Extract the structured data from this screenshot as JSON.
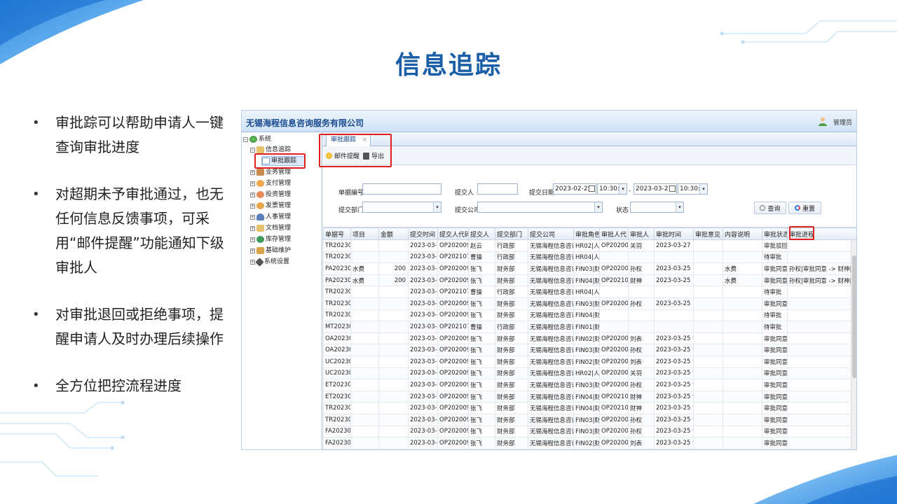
{
  "slide": {
    "title": "信息追踪",
    "bullets": [
      "审批踪可以帮助申请人一键查询审批进度",
      "对超期未予审批通过，也无任何信息反馈事项，可采用“邮件提醒”功能通知下级审批人",
      "对审批退回或拒绝事项，提醒申请人及时办理后续操作",
      "全方位把控流程进度"
    ]
  },
  "app": {
    "company": "无锡海程信息咨询服务有限公司",
    "user": "管理员",
    "tree": [
      {
        "label": "系统",
        "icon": "globe-icon",
        "expander": "⊟"
      },
      {
        "label": "信息追踪",
        "icon": "folder-icon",
        "expander": "⊟"
      },
      {
        "label": "审批跟踪",
        "icon": "document-icon",
        "expander": ""
      },
      {
        "label": "业务管理",
        "icon": "briefcase-icon",
        "expander": "⊞"
      },
      {
        "label": "支付管理",
        "icon": "payment-icon",
        "expander": "⊞"
      },
      {
        "label": "投资管理",
        "icon": "investment-icon",
        "expander": "⊞"
      },
      {
        "label": "发票管理",
        "icon": "invoice-icon",
        "expander": "⊞"
      },
      {
        "label": "人事管理",
        "icon": "person-icon",
        "expander": "⊞"
      },
      {
        "label": "文档管理",
        "icon": "document-folder-icon",
        "expander": "⊞"
      },
      {
        "label": "库存管理",
        "icon": "inventory-icon",
        "expander": "⊞"
      },
      {
        "label": "基础维护",
        "icon": "maintenance-icon",
        "expander": "⊞"
      },
      {
        "label": "系统设置",
        "icon": "wrench-icon",
        "expander": "⊞"
      }
    ],
    "tab": {
      "label": "审批跟踪",
      "close": "×"
    },
    "toolbar": {
      "mail": "邮件提醒",
      "export": "导出"
    },
    "search": {
      "doc_no_label": "单据编号",
      "submitter_label": "提交人",
      "date_label": "提交日期",
      "date_from": "2023-02-25",
      "time_from": "10:30:5",
      "date_sep": "-",
      "date_to": "2023-03-27",
      "time_to": "10:30:5",
      "dept_label": "提交部门",
      "company_label": "提交公司",
      "status_label": "状态",
      "search_btn": "查询",
      "reset_btn": "重置"
    },
    "columns": [
      "单据号",
      "项目",
      "金额",
      "提交时间",
      "提交人代码",
      "提交人",
      "提交部门",
      "提交公司",
      "审批角色",
      "审批人代",
      "审批人",
      "审批时间",
      "审批意见",
      "内容说明",
      "审批状态",
      "审批进程"
    ],
    "rows": [
      [
        "TR202303",
        "",
        "",
        "2023-03-27",
        "OP2020090",
        "赵云",
        "行政部",
        "无锡海程信息咨询",
        "HR02|人事",
        "OP2020009",
        "关羽",
        "2023-03-27 10:",
        "",
        "",
        "审批驳回",
        ""
      ],
      [
        "TR202303",
        "",
        "",
        "2023-03-25",
        "OP2021070",
        "曹操",
        "行政部",
        "无锡海程信息咨询",
        "HR04|人事",
        "",
        "",
        "",
        "",
        "",
        "待审批",
        ""
      ],
      [
        "PA202303",
        "水费",
        "200",
        "2023-03-25",
        "OP2020090",
        "张飞",
        "财务部",
        "无锡海程信息咨询",
        "FIN03|财务",
        "OP2020009",
        "孙权",
        "2023-03-25 11:",
        "",
        "水费",
        "审批同意",
        "孙权|审批同意 -> 财神|审"
      ],
      [
        "PA202303",
        "水费",
        "200",
        "2023-03-25",
        "OP2020090",
        "张飞",
        "财务部",
        "无锡海程信息咨询",
        "FIN04|财务",
        "OP2021070",
        "财神",
        "2023-03-25 11:",
        "",
        "水费",
        "审批同意",
        "孙权|审批同意 -> 财神|审"
      ],
      [
        "TR202303",
        "",
        "",
        "2023-03-25",
        "OP2021070",
        "曹操",
        "行政部",
        "无锡海程信息咨询",
        "HR04|人事",
        "",
        "",
        "",
        "",
        "",
        "待审批",
        ""
      ],
      [
        "TR202303",
        "",
        "",
        "2023-03-25",
        "OP2020090",
        "张飞",
        "财务部",
        "无锡海程信息咨询",
        "FIN03|财务",
        "OP2020009",
        "孙权",
        "2023-03-25 11:",
        "",
        "",
        "审批同意",
        ""
      ],
      [
        "TR202303",
        "",
        "",
        "2023-03-25",
        "OP2020090",
        "张飞",
        "财务部",
        "无锡海程信息咨询",
        "FIN04|财务",
        "",
        "",
        "",
        "",
        "",
        "待审批",
        ""
      ],
      [
        "MT202303",
        "",
        "",
        "2023-03-25",
        "OP2021070",
        "曹操",
        "行政部",
        "无锡海程信息咨询",
        "FIN01|财务",
        "",
        "",
        "",
        "",
        "",
        "待审批",
        ""
      ],
      [
        "OA202303",
        "",
        "",
        "2023-03-25",
        "OP2020090",
        "张飞",
        "财务部",
        "无锡海程信息咨询",
        "FIN02|财务",
        "OP2020009",
        "刘表",
        "2023-03-25 9:3",
        "",
        "",
        "审批同意",
        ""
      ],
      [
        "OA202303",
        "",
        "",
        "2023-03-25",
        "OP2020090",
        "张飞",
        "财务部",
        "无锡海程信息咨询",
        "FIN03|财务",
        "OP2020009",
        "孙权",
        "2023-03-25 9:3",
        "",
        "",
        "审批同意",
        ""
      ],
      [
        "UC202303",
        "",
        "",
        "2023-03-25",
        "OP2020090",
        "张飞",
        "财务部",
        "无锡海程信息咨询",
        "FIN02|财务",
        "OP2020009",
        "刘表",
        "2023-03-25 9:3",
        "",
        "",
        "审批同意",
        ""
      ],
      [
        "UC202303",
        "",
        "",
        "2023-03-25",
        "OP2020090",
        "张飞",
        "财务部",
        "无锡海程信息咨询",
        "HR02|人事",
        "OP2020009",
        "关羽",
        "2023-03-25 9:3",
        "",
        "",
        "审批同意",
        ""
      ],
      [
        "ET202303",
        "",
        "",
        "2023-03-25",
        "OP2020090",
        "张飞",
        "财务部",
        "无锡海程信息咨询",
        "FIN03|财务",
        "OP2020009",
        "孙权",
        "2023-03-25 9:2",
        "",
        "",
        "审批同意",
        ""
      ],
      [
        "ET202303",
        "",
        "",
        "2023-03-25",
        "OP2020090",
        "张飞",
        "财务部",
        "无锡海程信息咨询",
        "FIN04|财务",
        "OP2021070",
        "财神",
        "2023-03-25 9:2",
        "",
        "",
        "审批同意",
        ""
      ],
      [
        "TR202303",
        "",
        "",
        "2023-03-25",
        "OP2020090",
        "张飞",
        "财务部",
        "无锡海程信息咨询",
        "FIN04|财务",
        "OP2021070",
        "财神",
        "2023-03-25 9:2",
        "",
        "",
        "审批同意",
        ""
      ],
      [
        "TR202303",
        "",
        "",
        "2023-03-25",
        "OP2020090",
        "张飞",
        "财务部",
        "无锡海程信息咨询",
        "FIN03|财务",
        "OP2020009",
        "孙权",
        "2023-03-25 9:2",
        "",
        "",
        "审批同意",
        ""
      ],
      [
        "FA202303",
        "",
        "",
        "2023-03-25",
        "OP2020090",
        "张飞",
        "财务部",
        "无锡海程信息咨询",
        "FIN03|财务",
        "OP2020009",
        "孙权",
        "2023-03-25 9:1",
        "",
        "",
        "审批同意",
        ""
      ],
      [
        "FA202303",
        "",
        "",
        "2023-03-25",
        "OP2020090",
        "张飞",
        "财务部",
        "无锡海程信息咨询",
        "FIN02|财务",
        "OP2020009",
        "刘表",
        "2023-03-25 9:1",
        "",
        "",
        "审批同意",
        ""
      ]
    ]
  },
  "colors": {
    "title": "#1a5ea8",
    "highlight": "#e02020",
    "accent_blue": "#2e8de6"
  }
}
